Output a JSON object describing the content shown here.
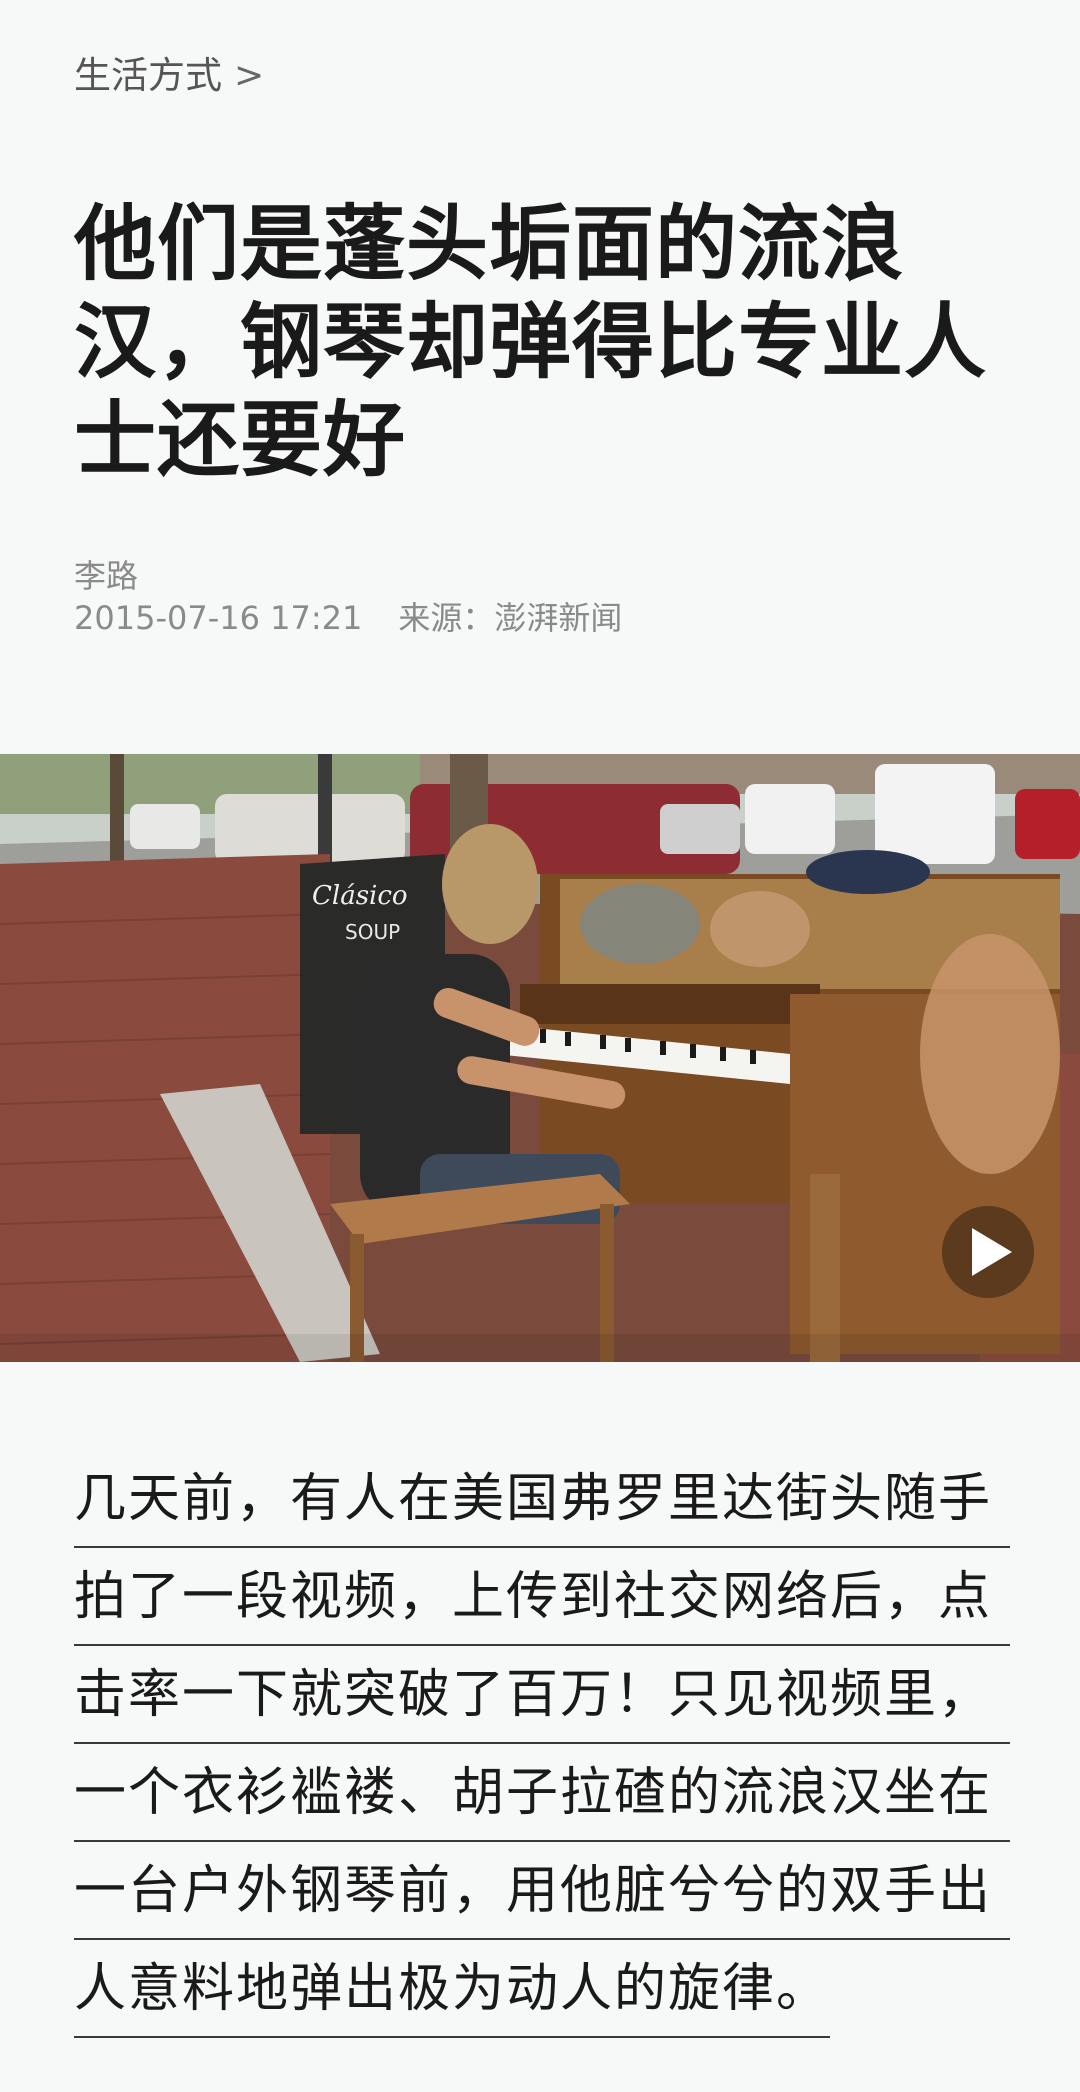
{
  "breadcrumb": {
    "label": "生活方式",
    "chevron": ">"
  },
  "article": {
    "title": "他们是蓬头垢面的流浪汉，钢琴却弹得比专业人士还要好",
    "title_lines": [
      "他们是蓬头垢面的流浪",
      "汉，钢琴却弹得比专业人",
      "士还要好"
    ],
    "author": "李路",
    "datetime": "2015-07-16 17:21",
    "source": "来源：澎湃新闻"
  },
  "video": {
    "poster_sign_text": "Clásico",
    "poster_sign_sub": "SOUP",
    "play_icon": "play-icon"
  },
  "body": {
    "lines": [
      "几天前，有人在美国弗罗里达街头随手",
      "拍了一段视频，上传到社交网络后，点",
      "击率一下就突破了百万！只见视频里，",
      "一个衣衫褴褛、胡子拉碴的流浪汉坐在",
      "一台户外钢琴前，用他脏兮兮的双手出",
      "人意料地弹出极为动人的旋律。"
    ]
  },
  "colors": {
    "background": "#f7f8f8",
    "title": "#1a1a1a",
    "meta": "#8a8a8a",
    "breadcrumb": "#555555"
  }
}
